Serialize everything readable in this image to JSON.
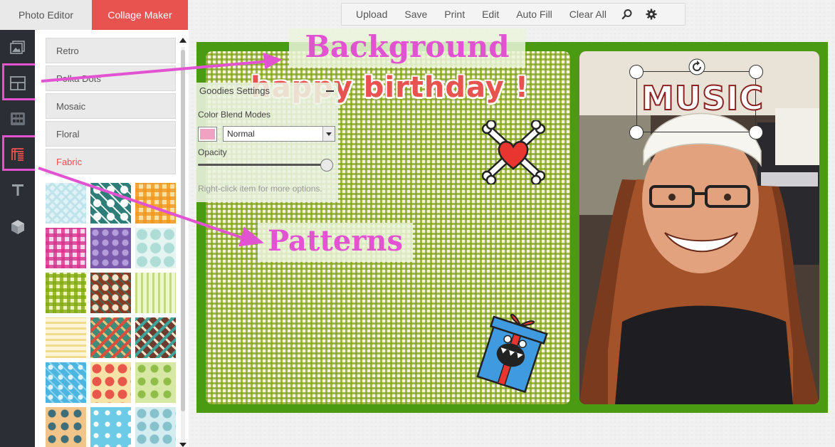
{
  "tabs": {
    "photo_editor": "Photo Editor",
    "collage_maker": "Collage Maker"
  },
  "toolbar": {
    "buttons": [
      "Upload",
      "Save",
      "Print",
      "Edit",
      "Auto Fill",
      "Clear All"
    ],
    "icons": [
      "search-icon",
      "gear-icon"
    ]
  },
  "rail": {
    "items": [
      "photos-icon",
      "layouts-icon",
      "grid-icon",
      "patterns-icon",
      "text-icon",
      "cube-icon"
    ],
    "selected": [
      "layouts-icon",
      "patterns-icon"
    ]
  },
  "panel": {
    "categories": [
      "Retro",
      "Polka Dots",
      "Mosaic",
      "Floral",
      "Fabric"
    ],
    "active_category": "Fabric",
    "swatches": [
      "chevron-light-blue",
      "teal-floral-tile",
      "orange-plaid",
      "pink-plaid",
      "purple-floral",
      "mint-dots",
      "green-plaid",
      "brown-diamond",
      "green-stripes",
      "yellow-stripes",
      "green-red-chevron",
      "brown-teal-chevron",
      "blue-floral-tile",
      "red-floral-tile",
      "green-floral",
      "orange-diamond",
      "sky-stars",
      "blue-petal"
    ]
  },
  "goodies": {
    "title": "Goodies Settings",
    "blend_label": "Color Blend Modes",
    "blend_color": "#f0a2c3",
    "blend_value": "Normal",
    "opacity_label": "Opacity",
    "opacity": 0.95,
    "hint": "Right-click item for more options."
  },
  "annotations": {
    "background": "Background",
    "patterns": "Patterns",
    "arrow_color": "#e253d2"
  },
  "stickers": {
    "birthday": "happy birthday !",
    "music": "MUSIC"
  },
  "colors": {
    "accent": "#e8524f",
    "frame": "#4a9a12",
    "rail": "#2b2f35"
  }
}
